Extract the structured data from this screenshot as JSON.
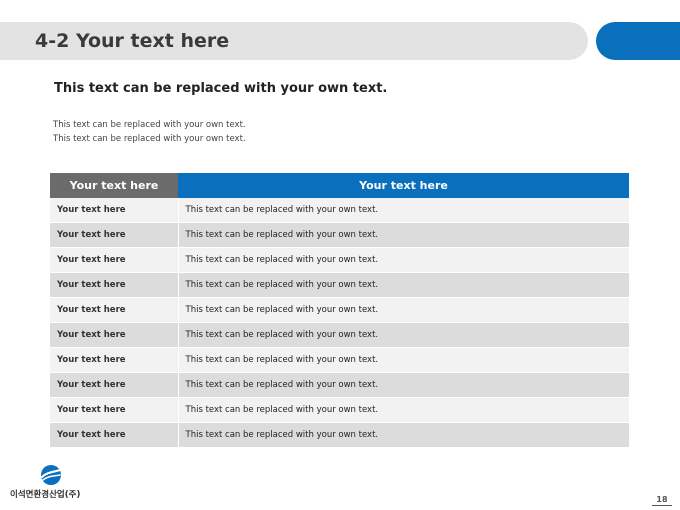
{
  "slide": {
    "title": "4-2 Your text here",
    "subtitle": "This text can be replaced with your own text.",
    "description": [
      "This text can be replaced with your own text.",
      "This text can be replaced with your own text."
    ]
  },
  "table": {
    "headers": [
      "Your text here",
      "Your text here"
    ],
    "rows": [
      [
        "Your text here",
        "This text can be replaced with your own text."
      ],
      [
        "Your text here",
        "This text can be replaced with your own text."
      ],
      [
        "Your text here",
        "This text can be replaced with your own text."
      ],
      [
        "Your text here",
        "This text can be replaced with your own text."
      ],
      [
        "Your text here",
        "This text can be replaced with your own text."
      ],
      [
        "Your text here",
        "This text can be replaced with your own text."
      ],
      [
        "Your text here",
        "This text can be replaced with your own text."
      ],
      [
        "Your text here",
        "This text can be replaced with your own text."
      ],
      [
        "Your text here",
        "This text can be replaced with your own text."
      ],
      [
        "Your text here",
        "This text can be replaced with your own text."
      ]
    ]
  },
  "footer": {
    "company": "이석면환경산업(주)",
    "page_number": "18",
    "logo_icon": "globe-swoosh-icon"
  },
  "colors": {
    "accent": "#0a6fbd",
    "title_bar": "#e3e3e3",
    "header_gray": "#6b6b6b",
    "row_light": "#f2f2f2",
    "row_dark": "#dcdcdc"
  }
}
